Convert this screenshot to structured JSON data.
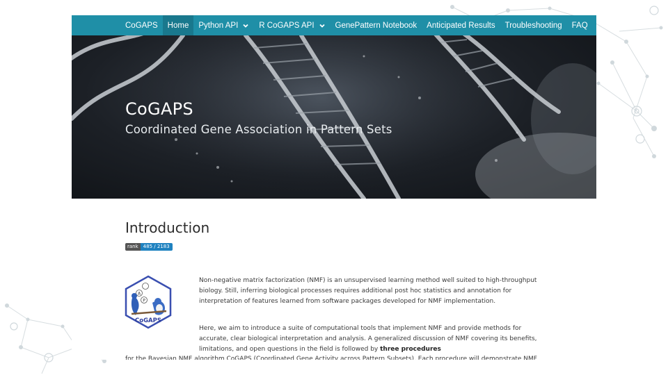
{
  "nav": {
    "items": [
      {
        "label": "CoGAPS",
        "active": false,
        "dropdown": false
      },
      {
        "label": "Home",
        "active": true,
        "dropdown": false
      },
      {
        "label": "Python API",
        "active": false,
        "dropdown": true
      },
      {
        "label": "R CoGAPS API",
        "active": false,
        "dropdown": true
      },
      {
        "label": "GenePattern Notebook",
        "active": false,
        "dropdown": false
      },
      {
        "label": "Anticipated Results",
        "active": false,
        "dropdown": false
      },
      {
        "label": "Troubleshooting",
        "active": false,
        "dropdown": false
      },
      {
        "label": "FAQ",
        "active": false,
        "dropdown": false
      }
    ],
    "color": "#1f8fa7"
  },
  "hero": {
    "title": "CoGAPS",
    "subtitle": "Coordinated Gene Association in Pattern Sets"
  },
  "main": {
    "heading": "Introduction",
    "badge": {
      "left": "rank",
      "right": "485 / 2183"
    },
    "logo": {
      "text": "CoGAPS",
      "letters": [
        "A",
        "P"
      ]
    },
    "paragraph1": "Non-negative matrix factorization (NMF) is an unsupervised learning method well suited to high-throughput biology. Still, inferring biological processes requires additional post hoc statistics and annotation for interpretation of features learned from software packages developed for NMF implementation.",
    "paragraph2_start": "Here, we aim to introduce a suite of computational tools that implement NMF and provide methods for accurate, clear biological interpretation and analysis. A generalized discussion of NMF covering its benefits, limitations, and open questions in the field is followed by",
    "paragraph2_bold": "three procedures",
    "paragraph2_end": "for the Bayesian NMF algorithm CoGAPS (Coordinated Gene Activity across Pattern Subsets). Each procedure will demonstrate NMF analysis to quantify cell state transitions in public domain single-cell RNA-sequencing (scRNA-seq)"
  }
}
